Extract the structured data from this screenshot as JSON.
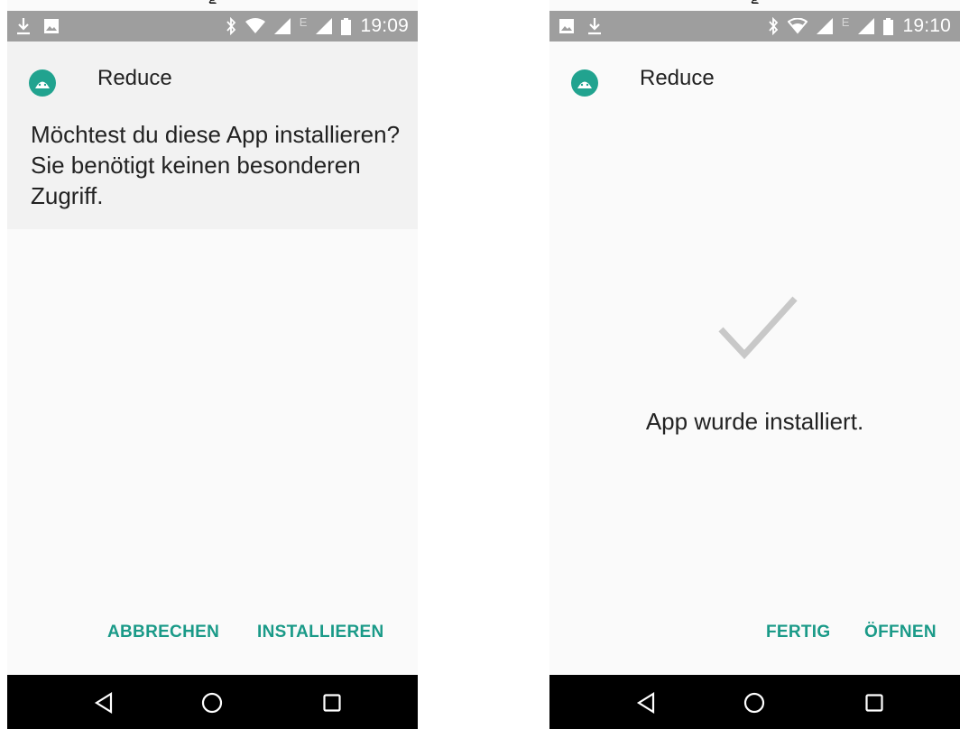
{
  "top_fragment": "g",
  "screens": [
    {
      "status": {
        "time": "19:09",
        "network_letter": "E"
      },
      "app": {
        "name": "Reduce"
      },
      "message": "Möchtest du diese App installieren? Sie benötigt keinen besonderen Zugriff.",
      "buttons": {
        "secondary": "ABBRECHEN",
        "primary": "INSTALLIEREN"
      }
    },
    {
      "status": {
        "time": "19:10",
        "network_letter": "E"
      },
      "app": {
        "name": "Reduce"
      },
      "message": "App wurde installiert.",
      "buttons": {
        "secondary": "FERTIG",
        "primary": "ÖFFNEN"
      }
    }
  ],
  "icons": {
    "left_status": [
      "download-icon",
      "image-icon"
    ],
    "right_status": [
      "image-icon",
      "download-icon"
    ],
    "system": [
      "bluetooth-icon",
      "wifi-icon",
      "signal-icon",
      "battery-icon"
    ],
    "nav": [
      "back-icon",
      "home-icon",
      "recents-icon"
    ]
  },
  "colors": {
    "accent": "#1a9a88",
    "app_icon": "#21a38f",
    "status_bar": "#9e9e9e",
    "header_bg": "#f2f2f2",
    "nav_bar": "#000000",
    "check": "#c8c8c8"
  }
}
